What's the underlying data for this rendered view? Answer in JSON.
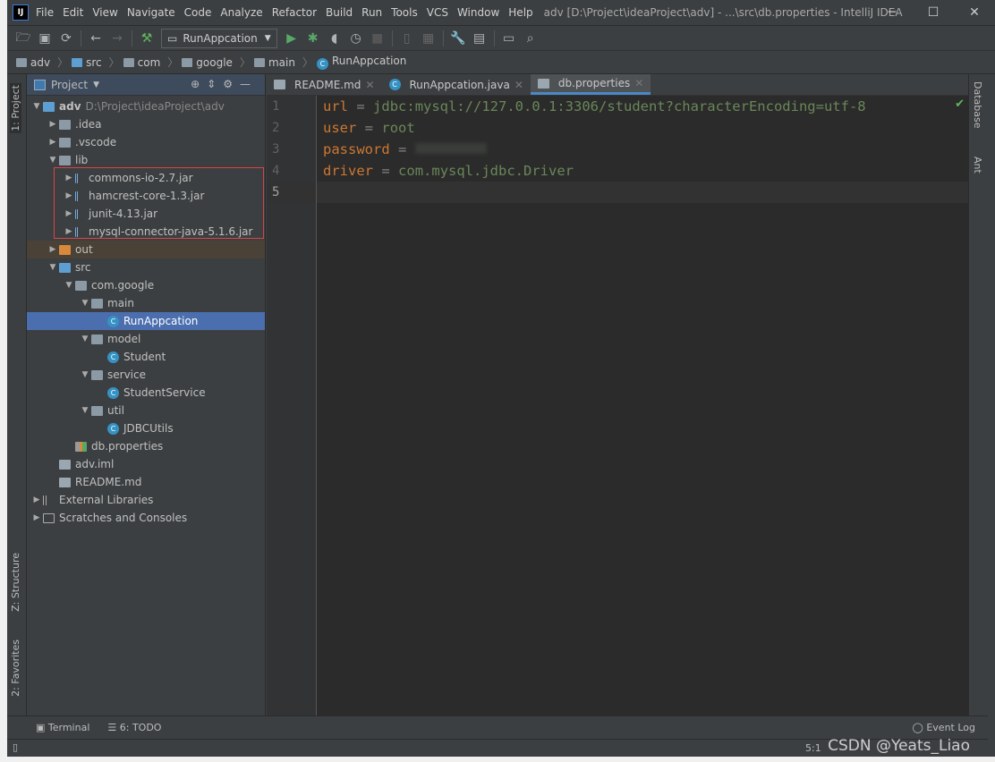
{
  "window": {
    "title": "adv [D:\\Project\\ideaProject\\adv] - ...\\src\\db.properties - IntelliJ IDEA",
    "logo": "IJ"
  },
  "menu": [
    "File",
    "Edit",
    "View",
    "Navigate",
    "Code",
    "Analyze",
    "Refactor",
    "Build",
    "Run",
    "Tools",
    "VCS",
    "Window",
    "Help"
  ],
  "toolbar": {
    "run_config": "RunAppcation"
  },
  "breadcrumb": [
    "adv",
    "src",
    "com",
    "google",
    "main",
    "RunAppcation"
  ],
  "left_strip": {
    "project": "1: Project",
    "structure": "Z: Structure",
    "favorites": "2: Favorites"
  },
  "right_strip": {
    "database": "Database",
    "ant": "Ant"
  },
  "project_panel": {
    "title": "Project",
    "tree": [
      {
        "label": "adv",
        "path": "D:\\Project\\ideaProject\\adv",
        "depth": 0,
        "arrow": "open",
        "icon": "module-folder"
      },
      {
        "label": ".idea",
        "depth": 1,
        "arrow": "closed",
        "icon": "folder"
      },
      {
        "label": ".vscode",
        "depth": 1,
        "arrow": "closed",
        "icon": "folder"
      },
      {
        "label": "lib",
        "depth": 1,
        "arrow": "open",
        "icon": "folder"
      },
      {
        "label": "commons-io-2.7.jar",
        "depth": 2,
        "arrow": "closed",
        "icon": "jar"
      },
      {
        "label": "hamcrest-core-1.3.jar",
        "depth": 2,
        "arrow": "closed",
        "icon": "jar"
      },
      {
        "label": "junit-4.13.jar",
        "depth": 2,
        "arrow": "closed",
        "icon": "jar"
      },
      {
        "label": "mysql-connector-java-5.1.6.jar",
        "depth": 2,
        "arrow": "closed",
        "icon": "jar"
      },
      {
        "label": "out",
        "depth": 1,
        "arrow": "closed",
        "icon": "folder-excluded"
      },
      {
        "label": "src",
        "depth": 1,
        "arrow": "open",
        "icon": "folder-source"
      },
      {
        "label": "com.google",
        "depth": 2,
        "arrow": "open",
        "icon": "package"
      },
      {
        "label": "main",
        "depth": 3,
        "arrow": "open",
        "icon": "package"
      },
      {
        "label": "RunAppcation",
        "depth": 4,
        "arrow": "",
        "icon": "class",
        "selected": true
      },
      {
        "label": "model",
        "depth": 3,
        "arrow": "open",
        "icon": "package"
      },
      {
        "label": "Student",
        "depth": 4,
        "arrow": "",
        "icon": "class"
      },
      {
        "label": "service",
        "depth": 3,
        "arrow": "open",
        "icon": "package"
      },
      {
        "label": "StudentService",
        "depth": 4,
        "arrow": "",
        "icon": "class"
      },
      {
        "label": "util",
        "depth": 3,
        "arrow": "open",
        "icon": "package"
      },
      {
        "label": "JDBCUtils",
        "depth": 4,
        "arrow": "",
        "icon": "class"
      },
      {
        "label": "db.properties",
        "depth": 2,
        "arrow": "",
        "icon": "properties"
      },
      {
        "label": "adv.iml",
        "depth": 1,
        "arrow": "",
        "icon": "iml"
      },
      {
        "label": "README.md",
        "depth": 1,
        "arrow": "",
        "icon": "markdown"
      },
      {
        "label": "External Libraries",
        "depth": 0,
        "arrow": "closed",
        "icon": "libraries"
      },
      {
        "label": "Scratches and Consoles",
        "depth": 0,
        "arrow": "closed",
        "icon": "scratches"
      }
    ]
  },
  "tabs": [
    {
      "label": "README.md",
      "active": false
    },
    {
      "label": "RunAppcation.java",
      "active": false
    },
    {
      "label": "db.properties",
      "active": true
    }
  ],
  "editor": {
    "lines": [
      {
        "key": "url",
        "value": "jdbc:mysql://127.0.0.1:3306/student?characterEncoding=utf-8"
      },
      {
        "key": "user",
        "value": "root"
      },
      {
        "key": "password",
        "value": ""
      },
      {
        "key": "driver",
        "value": "com.mysql.jdbc.Driver"
      },
      {
        "key": "",
        "value": ""
      }
    ],
    "line_numbers": [
      "1",
      "2",
      "3",
      "4",
      "5"
    ],
    "eq": "="
  },
  "bottom": {
    "terminal": "Terminal",
    "todo": "6: TODO",
    "event_log": "Event Log"
  },
  "status": {
    "position": "5:1",
    "watermark": "CSDN @Yeats_Liao"
  },
  "colors": {
    "key": "#cc7832",
    "value": "#6a8759",
    "selection": "#4b6eaf",
    "editor_bg": "#2b2b2b"
  }
}
